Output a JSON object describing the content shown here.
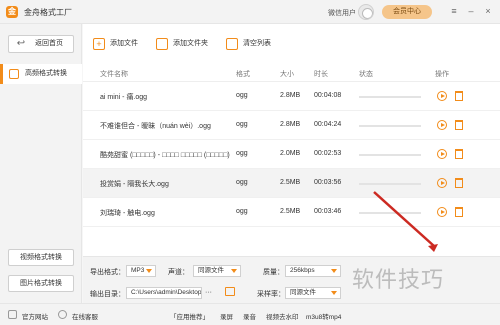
{
  "app": {
    "name": "金舟格式工厂",
    "logo_glyph": "金"
  },
  "titlebar": {
    "wechat_user": "微信用户",
    "member_button": "会员中心",
    "menu_icon": "≡",
    "minimize_icon": "–",
    "close_icon": "×"
  },
  "sidebar": {
    "back_button": "返回首页",
    "active_item": "高频格式转换",
    "video_button": "视频格式转换",
    "image_button": "图片格式转换"
  },
  "toolbar": {
    "add_file": "添加文件",
    "add_folder": "添加文件夹",
    "clear_list": "清空列表"
  },
  "list": {
    "headers": {
      "name": "文件名称",
      "format": "格式",
      "size": "大小",
      "duration": "时长",
      "status": "状态",
      "action": "操作"
    },
    "rows": [
      {
        "name": "ai mini - 痛.ogg",
        "format": "ogg",
        "size": "2.8MB",
        "duration": "00:04:08"
      },
      {
        "name": "不难谁但合 - 暧昧（nuán wèi）.ogg",
        "format": "ogg",
        "size": "2.8MB",
        "duration": "00:04:24"
      },
      {
        "name": "酷苑甜蜜 (□□□□□) - □□□□ □□□□□ (□□□□□) ...",
        "format": "ogg",
        "size": "2.0MB",
        "duration": "00:02:53"
      },
      {
        "name": "投赏娟 - 隔我长大.ogg",
        "format": "ogg",
        "size": "2.5MB",
        "duration": "00:03:56"
      },
      {
        "name": "刘瑞琦 - 触电.ogg",
        "format": "ogg",
        "size": "2.5MB",
        "duration": "00:03:46"
      }
    ]
  },
  "bottom": {
    "output_format_label": "导出格式：",
    "output_format_value": "MP3",
    "channel_label": "声道：",
    "channel_value": "同源文件",
    "quality_label": "质量：",
    "quality_value": "256kbps",
    "output_dir_label": "输出目录：",
    "output_dir_value": "C:\\Users\\admin\\Desktop\\",
    "more_button": "···",
    "sample_rate_label": "采样率：",
    "sample_rate_value": "同源文件"
  },
  "statusbar": {
    "website": "官方网站",
    "service": "在线客服",
    "recommend": "「应用推荐」",
    "record": "录屏",
    "record2": "录音",
    "video_watermark": "视频去水印",
    "m3u8": "m3u8转mp4"
  },
  "watermark": "软件技巧",
  "colors": {
    "accent": "#f28c1a",
    "arrow": "#cc2a22"
  }
}
